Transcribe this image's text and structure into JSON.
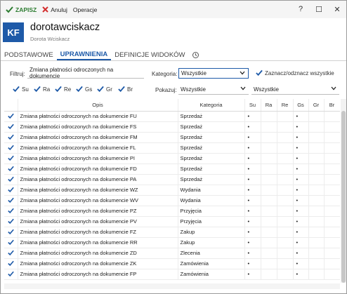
{
  "toolbar": {
    "save_label": "ZAPISZ",
    "cancel_label": "Anuluj",
    "operations_label": "Operacje"
  },
  "window_controls": {
    "help": "?",
    "maximize": "☐",
    "close": "✕"
  },
  "header": {
    "avatar_initials": "KF",
    "title": "dorotawciskacz",
    "subtitle": "Dorota Wciskacz"
  },
  "tabs": [
    {
      "label": "PODSTAWOWE"
    },
    {
      "label": "UPRAWNIENIA"
    },
    {
      "label": "DEFINICJE WIDOKÓW"
    }
  ],
  "filters": {
    "filter_label": "Filtruj:",
    "filter_value": "Zmiana płatności odroczonych na dokumencie",
    "category_label": "Kategoria:",
    "category_value": "Wszystkie",
    "toggle_all_label": "Zaznacz/odznacz wszystkie",
    "show_label": "Pokazuj:",
    "show_value": "Wszystkie",
    "show_value2": "Wszystkie",
    "flags": [
      "Su",
      "Ra",
      "Re",
      "Gs",
      "Gr",
      "Br"
    ]
  },
  "table": {
    "columns": [
      "Opis",
      "Kategoria",
      "Su",
      "Ra",
      "Re",
      "Gs",
      "Gr",
      "Br"
    ],
    "rows": [
      {
        "opis": "Zmiana płatności odroczonych na dokumencie FU",
        "kategoria": "Sprzedaż",
        "su": "•",
        "ra": "",
        "re": "",
        "gs": "•",
        "gr": "",
        "br": ""
      },
      {
        "opis": "Zmiana płatności odroczonych na dokumencie FS",
        "kategoria": "Sprzedaż",
        "su": "•",
        "ra": "",
        "re": "",
        "gs": "•",
        "gr": "",
        "br": ""
      },
      {
        "opis": "Zmiana płatności odroczonych na dokumencie FM",
        "kategoria": "Sprzedaż",
        "su": "•",
        "ra": "",
        "re": "",
        "gs": "•",
        "gr": "",
        "br": ""
      },
      {
        "opis": "Zmiana płatności odroczonych na dokumencie FL",
        "kategoria": "Sprzedaż",
        "su": "•",
        "ra": "",
        "re": "",
        "gs": "•",
        "gr": "",
        "br": ""
      },
      {
        "opis": "Zmiana płatności odroczonych na dokumencie PI",
        "kategoria": "Sprzedaż",
        "su": "•",
        "ra": "",
        "re": "",
        "gs": "•",
        "gr": "",
        "br": ""
      },
      {
        "opis": "Zmiana płatności odroczonych na dokumencie FD",
        "kategoria": "Sprzedaż",
        "su": "•",
        "ra": "",
        "re": "",
        "gs": "•",
        "gr": "",
        "br": ""
      },
      {
        "opis": "Zmiana płatności odroczonych na dokumencie PA",
        "kategoria": "Sprzedaż",
        "su": "•",
        "ra": "",
        "re": "",
        "gs": "•",
        "gr": "",
        "br": ""
      },
      {
        "opis": "Zmiana płatności odroczonych na dokumencie WZ",
        "kategoria": "Wydania",
        "su": "•",
        "ra": "",
        "re": "",
        "gs": "•",
        "gr": "",
        "br": ""
      },
      {
        "opis": "Zmiana płatności odroczonych na dokumencie WV",
        "kategoria": "Wydania",
        "su": "•",
        "ra": "",
        "re": "",
        "gs": "•",
        "gr": "",
        "br": ""
      },
      {
        "opis": "Zmiana płatności odroczonych na dokumencie PZ",
        "kategoria": "Przyjęcia",
        "su": "•",
        "ra": "",
        "re": "",
        "gs": "•",
        "gr": "",
        "br": ""
      },
      {
        "opis": "Zmiana płatności odroczonych na dokumencie PV",
        "kategoria": "Przyjęcia",
        "su": "•",
        "ra": "",
        "re": "",
        "gs": "•",
        "gr": "",
        "br": ""
      },
      {
        "opis": "Zmiana płatności odroczonych na dokumencie FZ",
        "kategoria": "Zakup",
        "su": "•",
        "ra": "",
        "re": "",
        "gs": "•",
        "gr": "",
        "br": ""
      },
      {
        "opis": "Zmiana płatności odroczonych na dokumencie RR",
        "kategoria": "Zakup",
        "su": "•",
        "ra": "",
        "re": "",
        "gs": "•",
        "gr": "",
        "br": ""
      },
      {
        "opis": "Zmiana płatności odroczonych na dokumencie ZD",
        "kategoria": "Zlecenia",
        "su": "•",
        "ra": "",
        "re": "",
        "gs": "•",
        "gr": "",
        "br": ""
      },
      {
        "opis": "Zmiana płatności odroczonych na dokumencie ZK",
        "kategoria": "Zamówienia",
        "su": "•",
        "ra": "",
        "re": "",
        "gs": "•",
        "gr": "",
        "br": ""
      },
      {
        "opis": "Zmiana płatności odroczonych na dokumencie FP",
        "kategoria": "Zamówienia",
        "su": "•",
        "ra": "",
        "re": "",
        "gs": "•",
        "gr": "",
        "br": ""
      }
    ]
  },
  "icons": {
    "check": "check-icon",
    "close": "close-icon",
    "chevron": "chevron-down-icon",
    "history": "history-icon"
  },
  "colors": {
    "accent": "#1e5aa8",
    "save": "#2e7d32",
    "cancel": "#d32f2f"
  }
}
